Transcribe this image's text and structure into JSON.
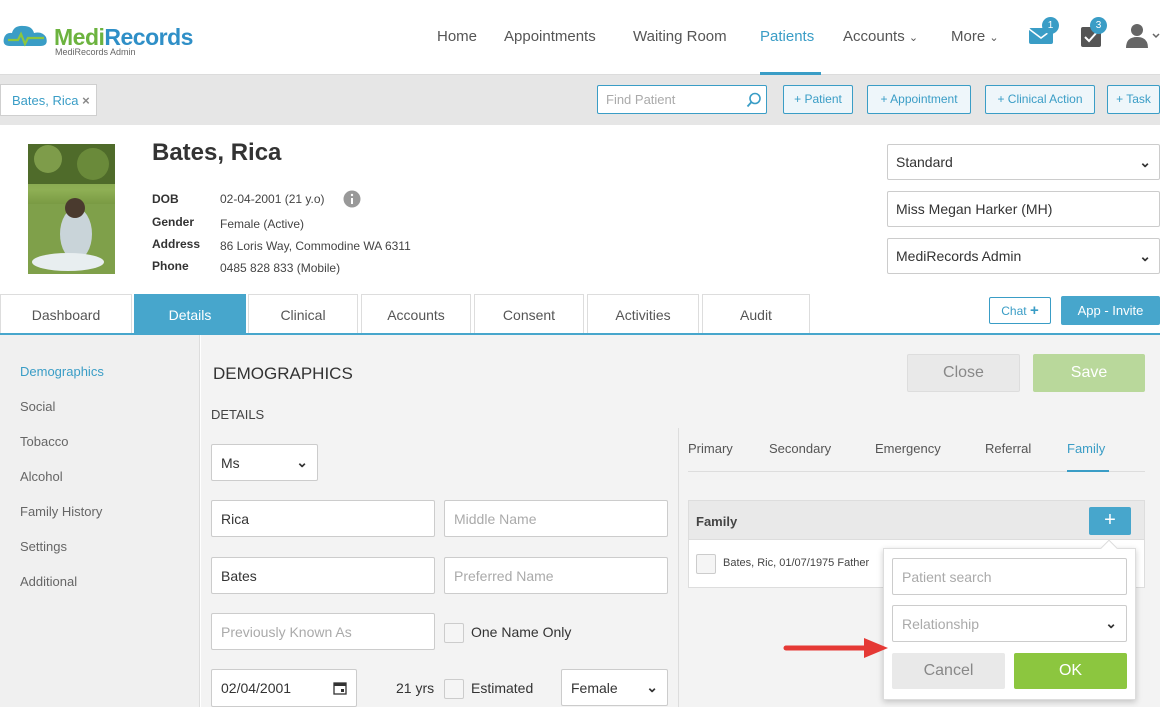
{
  "brand": {
    "name_part1": "Medi",
    "name_part2": "Records",
    "sub": "MediRecords Admin"
  },
  "nav": {
    "home": "Home",
    "appointments": "Appointments",
    "waiting_room": "Waiting Room",
    "patients": "Patients",
    "accounts": "Accounts",
    "more": "More",
    "mail_count": "1",
    "tasks_count": "3"
  },
  "toolbar": {
    "patient_tab": "Bates, Rica",
    "find_placeholder": "Find Patient",
    "add_patient": "+ Patient",
    "add_appointment": "+ Appointment",
    "add_clinical_action": "+ Clinical Action",
    "add_task": "+ Task"
  },
  "patient": {
    "name": "Bates, Rica",
    "dob_label": "DOB",
    "dob": "02-04-2001 (21 y.o)",
    "gender_label": "Gender",
    "gender": "Female (Active)",
    "address_label": "Address",
    "address": "86 Loris Way, Commodine WA 6311",
    "phone_label": "Phone",
    "phone": "0485 828 833 (Mobile)"
  },
  "header_selects": {
    "type": "Standard",
    "practitioner": "Miss Megan Harker (MH)",
    "practice": "MediRecords Admin"
  },
  "tabs": {
    "dashboard": "Dashboard",
    "details": "Details",
    "clinical": "Clinical",
    "accounts": "Accounts",
    "consent": "Consent",
    "activities": "Activities",
    "audit": "Audit",
    "chat": "Chat",
    "app_invite": "App - Invite"
  },
  "sidebar": {
    "demographics": "Demographics",
    "social": "Social",
    "tobacco": "Tobacco",
    "alcohol": "Alcohol",
    "family_history": "Family History",
    "settings": "Settings",
    "additional": "Additional"
  },
  "main": {
    "title": "DEMOGRAPHICS",
    "section": "DETAILS",
    "close": "Close",
    "save": "Save",
    "title_select": "Ms",
    "first_name": "Rica",
    "middle_placeholder": "Middle Name",
    "last_name": "Bates",
    "preferred_placeholder": "Preferred Name",
    "pka_placeholder": "Previously Known As",
    "one_name_only": "One Name Only",
    "dob": "02/04/2001",
    "age": "21 yrs",
    "estimated": "Estimated",
    "sex": "Female"
  },
  "contacts": {
    "tabs": {
      "primary": "Primary",
      "secondary": "Secondary",
      "emergency": "Emergency",
      "referral": "Referral",
      "family": "Family"
    },
    "family_header": "Family",
    "family_row": "Bates, Ric, 01/07/1975 Father",
    "popup": {
      "search_placeholder": "Patient search",
      "relationship_placeholder": "Relationship",
      "cancel": "Cancel",
      "ok": "OK"
    }
  }
}
